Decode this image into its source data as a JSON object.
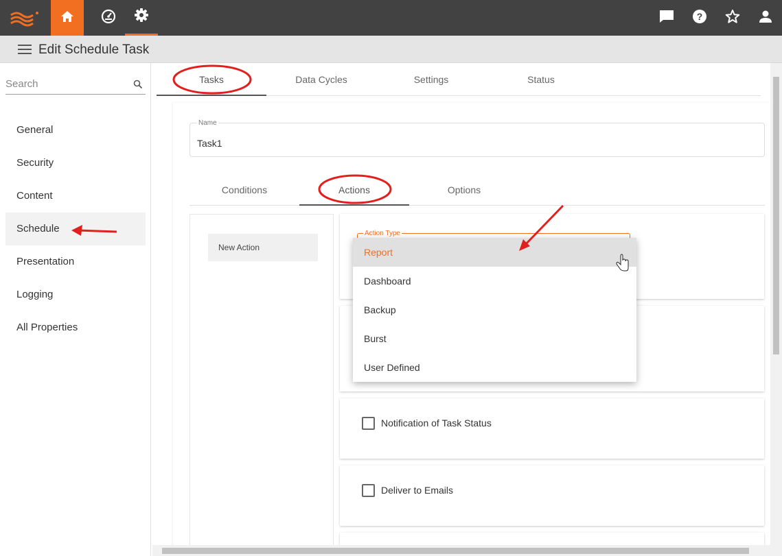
{
  "topbar": {
    "logo_icon": "brand-logo-icon",
    "nav": [
      {
        "icon": "home-icon"
      },
      {
        "icon": "dashboard-gauge-icon"
      },
      {
        "icon": "gear-icon"
      }
    ],
    "right_icons": [
      "message-icon",
      "help-icon",
      "star-icon",
      "user-icon"
    ],
    "accent_color": "#f26f21"
  },
  "header": {
    "title": "Edit Schedule Task"
  },
  "sidebar": {
    "search_placeholder": "Search",
    "items": [
      {
        "label": "General"
      },
      {
        "label": "Security"
      },
      {
        "label": "Content"
      },
      {
        "label": "Schedule",
        "active": true
      },
      {
        "label": "Presentation"
      },
      {
        "label": "Logging"
      },
      {
        "label": "All Properties"
      }
    ]
  },
  "tabs": [
    {
      "label": "Tasks",
      "active": true
    },
    {
      "label": "Data Cycles"
    },
    {
      "label": "Settings"
    },
    {
      "label": "Status"
    }
  ],
  "task": {
    "name_label": "Name",
    "name_value": "Task1",
    "subtabs": [
      {
        "label": "Conditions"
      },
      {
        "label": "Actions",
        "active": true
      },
      {
        "label": "Options"
      }
    ],
    "new_action": "New Action",
    "action_type_label": "Action Type",
    "action_type_options": [
      "Report",
      "Dashboard",
      "Backup",
      "Burst",
      "User Defined"
    ],
    "action_type_selected": "Report",
    "notification_label": "Notification of Task Status",
    "deliver_label": "Deliver to Emails"
  }
}
